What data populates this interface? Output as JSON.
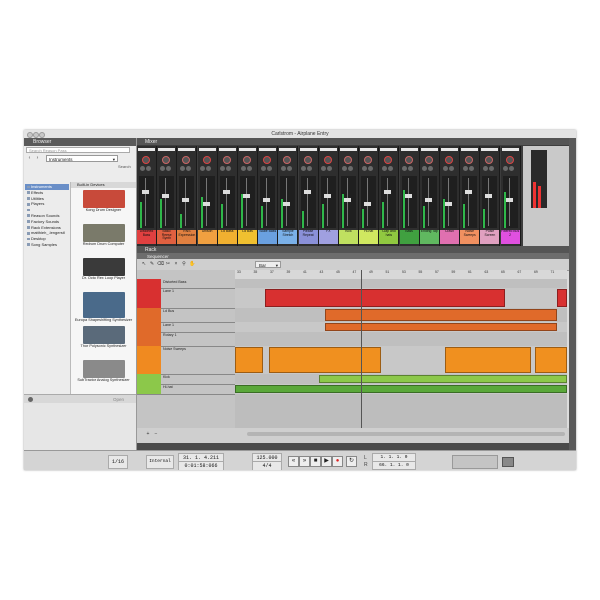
{
  "window": {
    "title": "Carlstrom - Airplane Entry"
  },
  "browser": {
    "title": "Browser",
    "search_placeholder": "Search Reason Pass",
    "location": "Instruments",
    "search_label": "Search",
    "tree": [
      {
        "label": "Instruments",
        "selected": true
      },
      {
        "label": "Effects"
      },
      {
        "label": "Utilities"
      },
      {
        "label": "Players"
      },
      {
        "label": ""
      },
      {
        "label": "Reason Sounds"
      },
      {
        "label": "Factory Sounds"
      },
      {
        "label": "Rack Extensions"
      },
      {
        "label": "matthieh_.lengerstl"
      },
      {
        "label": "Desktop"
      },
      {
        "label": "Song Samples"
      }
    ],
    "devices_header": "Built-in Devices",
    "devices": [
      {
        "name": "Kong Drum Designer",
        "color": "#c84a3a"
      },
      {
        "name": "Redrum Drum Computer",
        "color": "#7a7a6a"
      },
      {
        "name": "Dr. Octo Rex Loop Player",
        "color": "#3a3a3a"
      },
      {
        "name": "Europa Shapeshifting Synthesizer",
        "color": "#4a6a8a"
      },
      {
        "name": "Thor Polysonic Synthesizer",
        "color": "#5a6a7a"
      },
      {
        "name": "SubTractor Analog Synthesizer",
        "color": "#8a8a8a"
      }
    ],
    "open_label": "Open"
  },
  "mixer": {
    "title": "Mixer",
    "channels": [
      {
        "label": "Distorted Bass",
        "color": "#e04040"
      },
      {
        "label": "Basic Reese Synth",
        "color": "#e06040"
      },
      {
        "label": "RNS Expression",
        "color": "#e08040"
      },
      {
        "label": "Unison",
        "color": "#f0a040"
      },
      {
        "label": "Ld Bass",
        "color": "#f0b030"
      },
      {
        "label": "Ld Bas",
        "color": "#f0c030"
      },
      {
        "label": "Scale Bass",
        "color": "#6aa0e0"
      },
      {
        "label": "Sample Stretch",
        "color": "#7ab0e8"
      },
      {
        "label": "Please Repeat",
        "color": "#8a90d8"
      },
      {
        "label": "FX",
        "color": "#a0a0e0"
      },
      {
        "label": "Kick",
        "color": "#c0e060"
      },
      {
        "label": "Hi-hat",
        "color": "#d0e860"
      },
      {
        "label": "Clap and hats",
        "color": "#90c840"
      },
      {
        "label": "Bass",
        "color": "#40a040"
      },
      {
        "label": "Ending Tap",
        "color": "#60b860"
      },
      {
        "label": "Crash",
        "color": "#e070b0"
      },
      {
        "label": "Noise Sweeps",
        "color": "#f09060"
      },
      {
        "label": "Pulse Screen",
        "color": "#e0a0c0"
      },
      {
        "label": "Filtered Bus 2",
        "color": "#e050e0"
      }
    ]
  },
  "rack": {
    "title": "Rack"
  },
  "sequencer": {
    "title": "Sequencer",
    "snap_value": "Bar",
    "tracks": [
      {
        "name": "Distorted Bass",
        "color": "#d83030"
      },
      {
        "name": "Lane 1",
        "color": "#d83030"
      },
      {
        "name": "Ld Bus",
        "color": "#e06a2a"
      },
      {
        "name": "Lane 1",
        "color": "#e06a2a"
      },
      {
        "name": "Rotary 1",
        "color": "#e06a2a"
      },
      {
        "name": "Noise Sweeps",
        "color": "#f08a20"
      },
      {
        "name": "Kick",
        "color": "#8cc84a"
      },
      {
        "name": "Hi-hat",
        "color": "#8cc84a"
      }
    ],
    "ruler": [
      "33",
      "35",
      "37",
      "39",
      "41",
      "43",
      "45",
      "47",
      "49",
      "51",
      "53",
      "55",
      "57",
      "59",
      "61",
      "63",
      "65",
      "67",
      "69",
      "71"
    ]
  },
  "transport": {
    "quantize": "1/16",
    "sync_mode": "Internal",
    "position_bars": "31.  1.  4.211",
    "position_time": "0:01:58:066",
    "tempo": "125.000",
    "signature": "4/4",
    "loop_left": "1.  1.  1.  0",
    "loop_right": "66.  1.  1.  0",
    "left_label": "L",
    "right_label": "R"
  }
}
